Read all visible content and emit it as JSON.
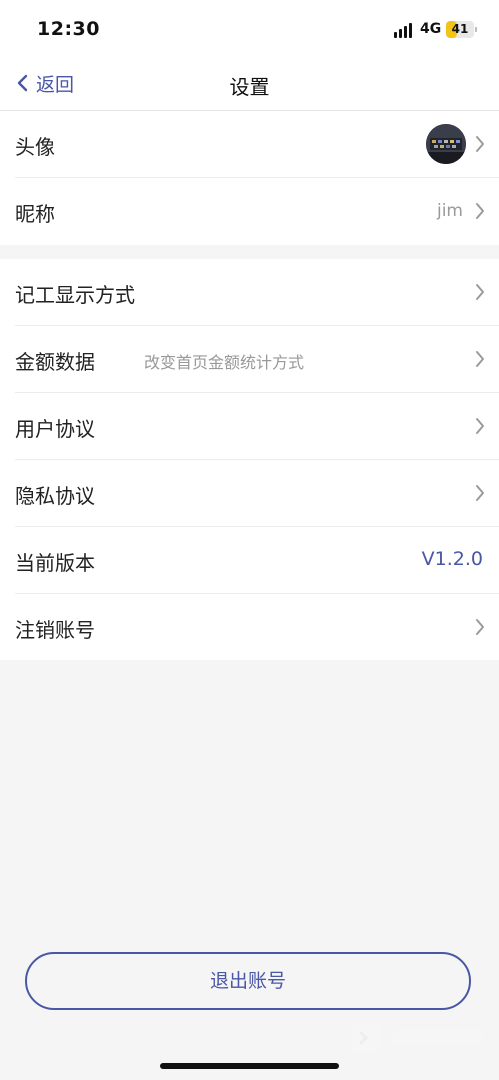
{
  "status_bar": {
    "time": "12:30",
    "network": "4G",
    "battery": "41",
    "battery_level": 0.41
  },
  "nav": {
    "back_label": "返回",
    "title": "设置"
  },
  "group1": [
    {
      "title": "头像",
      "type": "avatar"
    },
    {
      "title": "昵称",
      "value": "jim"
    }
  ],
  "group2": [
    {
      "title": "记工显示方式"
    },
    {
      "title": "金额数据",
      "subtitle": "改变首页金额统计方式"
    },
    {
      "title": "用户协议"
    },
    {
      "title": "隐私协议"
    },
    {
      "title": "当前版本",
      "value": "V1.2.0"
    },
    {
      "title": "注销账号"
    }
  ],
  "logout_label": "退出账号",
  "colors": {
    "accent": "#4a56a6",
    "background": "#f5f5f5",
    "battery": "#f2c515"
  },
  "icons": [
    "chevron-left-icon",
    "chevron-right-icon",
    "signal-icon",
    "battery-icon"
  ]
}
